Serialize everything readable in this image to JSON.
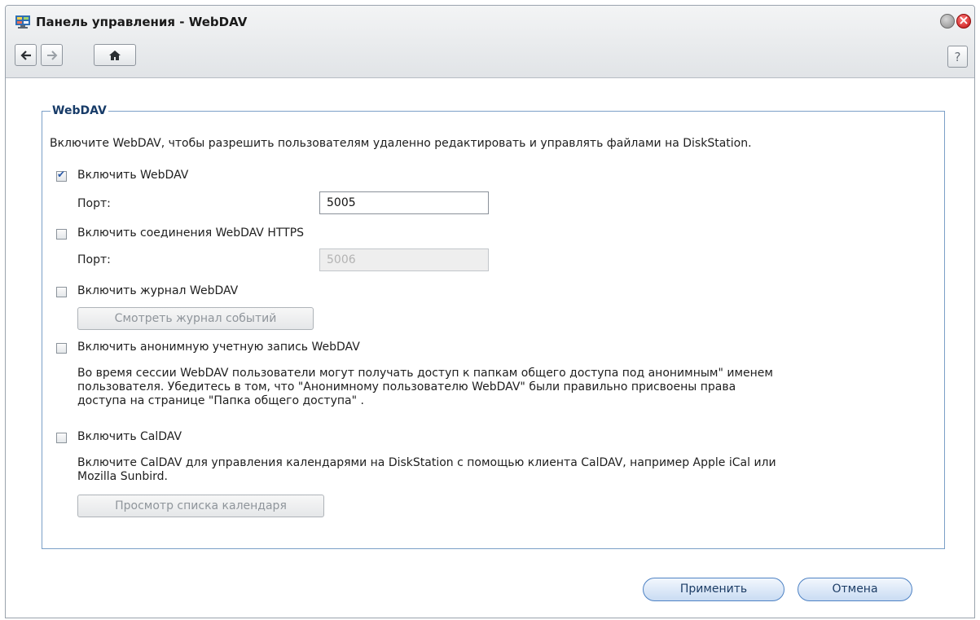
{
  "window": {
    "title": "Панель управления - WebDAV",
    "help_label": "?"
  },
  "group": {
    "legend": "WebDAV",
    "description": "Включите WebDAV, чтобы разрешить пользователям удаленно редактировать и управлять файлами на DiskStation.",
    "webdav": {
      "label": "Включить WebDAV",
      "checked": true,
      "port_label": "Порт:",
      "port_value": "5005"
    },
    "https": {
      "label": "Включить соединения WebDAV HTTPS",
      "checked": false,
      "port_label": "Порт:",
      "port_value": "5006"
    },
    "log": {
      "label": "Включить журнал WebDAV",
      "checked": false,
      "view_button": "Смотреть журнал событий"
    },
    "anonymous": {
      "label": "Включить анонимную учетную запись WebDAV",
      "checked": false,
      "note_lines": [
        "Во время сессии WebDAV пользователи могут получать доступ к папкам общего доступа под анонимным\" именем",
        "пользователя. Убедитесь в том, что \"Анонимному пользователю WebDAV\" были правильно присвоены права",
        "доступа на странице \"Папка общего доступа\" ."
      ]
    },
    "caldav": {
      "label": "Включить CalDAV",
      "checked": false,
      "note_lines": [
        "Включите CalDAV для управления календарями на DiskStation с помощью клиента CalDAV, например Apple iCal или",
        "Mozilla Sunbird."
      ],
      "list_button": "Просмотр списка календаря"
    }
  },
  "footer": {
    "apply_label": "Применить",
    "cancel_label": "Отмена"
  }
}
